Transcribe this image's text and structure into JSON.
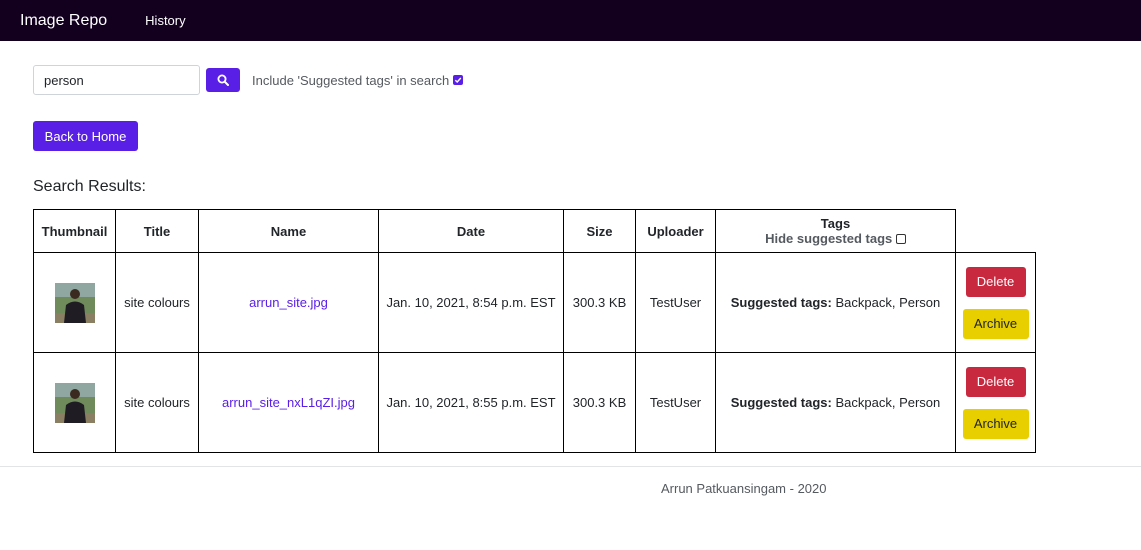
{
  "navbar": {
    "brand": "Image Repo",
    "history_link": "History",
    "background": "#13001f"
  },
  "search": {
    "value": "person",
    "button_icon": "search-icon",
    "include_label": "Include 'Suggested tags' in search",
    "include_checked": true
  },
  "back_home_label": "Back to Home",
  "results_heading": "Search Results:",
  "table": {
    "headers": {
      "thumbnail": "Thumbnail",
      "title": "Title",
      "name": "Name",
      "date": "Date",
      "size": "Size",
      "uploader": "Uploader",
      "tags": "Tags",
      "hide_suggested": "Hide suggested tags"
    },
    "rows": [
      {
        "title": "site colours",
        "name": "arrun_site.jpg",
        "date": "Jan. 10, 2021, 8:54 p.m. EST",
        "size": "300.3 KB",
        "uploader": "TestUser",
        "suggested_label": "Suggested tags:",
        "suggested_tags": "Backpack, Person",
        "delete_label": "Delete",
        "archive_label": "Archive"
      },
      {
        "title": "site colours",
        "name": "arrun_site_nxL1qZI.jpg",
        "date": "Jan. 10, 2021, 8:55 p.m. EST",
        "size": "300.3 KB",
        "uploader": "TestUser",
        "suggested_label": "Suggested tags:",
        "suggested_tags": "Backpack, Person",
        "delete_label": "Delete",
        "archive_label": "Archive"
      }
    ]
  },
  "footer": "Arrun Patkuansingam - 2020",
  "colors": {
    "primary": "#5a1fe6",
    "danger": "#c8293f",
    "warning": "#e8cf00"
  }
}
